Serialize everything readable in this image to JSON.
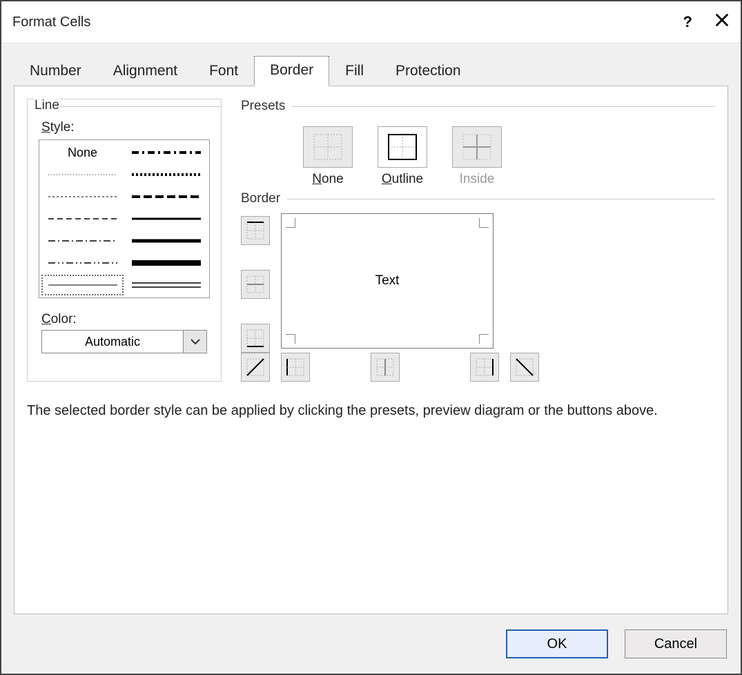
{
  "title": "Format Cells",
  "tabs": [
    "Number",
    "Alignment",
    "Font",
    "Border",
    "Fill",
    "Protection"
  ],
  "active_tab": "Border",
  "line": {
    "group_label": "Line",
    "style_label": "Style:",
    "none_label": "None",
    "color_label": "Color:",
    "color_value": "Automatic"
  },
  "presets": {
    "group_label": "Presets",
    "none": "None",
    "outline": "Outline",
    "inside": "Inside"
  },
  "border": {
    "group_label": "Border",
    "preview_text": "Text"
  },
  "hint": "The selected border style can be applied by clicking the presets, preview diagram or the buttons above.",
  "buttons": {
    "ok": "OK",
    "cancel": "Cancel"
  }
}
